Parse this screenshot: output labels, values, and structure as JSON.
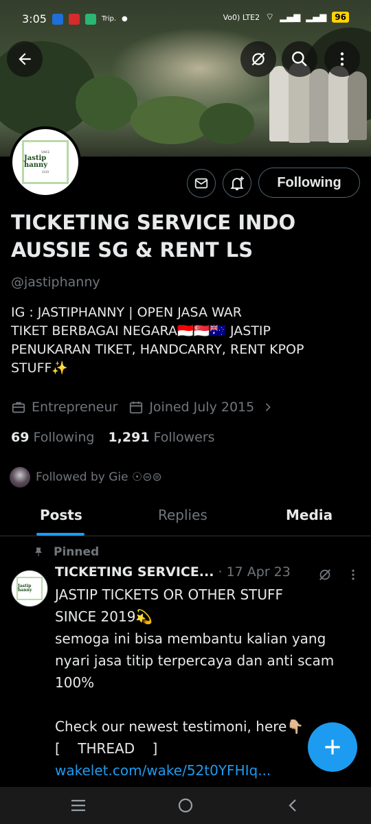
{
  "status_bar": {
    "time": "3:05",
    "trip_label": "Trip.",
    "network": "Vo0) LTE2",
    "battery": "96"
  },
  "profile": {
    "avatar_text": "Jastip hanny",
    "avatar_small_top": "SINCE",
    "avatar_small_bottom": "2019",
    "following_button": "Following",
    "name": "TICKETING SERVICE INDO AUSSIE SG & RENT LS",
    "handle": "@jastiphanny",
    "bio_lines": [
      "IG : JASTIPHANNY | OPEN JASA WAR",
      "TIKET BERBAGAI NEGARA🇮🇩🇸🇬🇦🇺 JASTIP",
      "PENUKARAN TIKET, HANDCARRY, RENT KPOP",
      "STUFF✨"
    ],
    "category": "Entrepreneur",
    "joined": "Joined July 2015",
    "following_count": "69",
    "following_label": "Following",
    "followers_count": "1,291",
    "followers_label": "Followers",
    "followed_by": "Followed by Gie ☉⊝⊜"
  },
  "tabs": [
    {
      "label": "Posts",
      "active": true
    },
    {
      "label": "Replies",
      "active": false
    },
    {
      "label": "Media",
      "active": false
    }
  ],
  "pinned_tweet": {
    "pinned_label": "Pinned",
    "author": "TICKETING SERVICE...",
    "date": "· 17 Apr 23",
    "lines": [
      "JASTIP TICKETS OR OTHER STUFF",
      "SINCE 2019💫",
      "semoga ini bisa membantu kalian yang",
      "nyari jasa titip terpercaya dan anti scam",
      "100%",
      "",
      "Check our newest testimoni, here👇🏼",
      "[    THREAD    ]"
    ],
    "link": "wakelet.com/wake/52t0YFHIq..."
  },
  "colors": {
    "accent": "#1d9bf0",
    "text": "#e7e9ea",
    "muted": "#71767b",
    "background": "#000000"
  },
  "icons": [
    "back-arrow-icon",
    "grok-icon",
    "search-icon",
    "more-icon",
    "mail-icon",
    "bell-plus-icon",
    "briefcase-icon",
    "calendar-icon",
    "chevron-right-icon",
    "pin-icon",
    "compose-plus-icon"
  ]
}
